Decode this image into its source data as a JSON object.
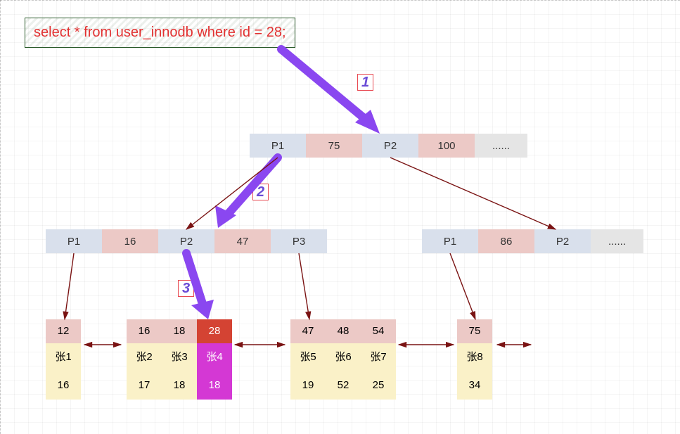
{
  "sql": "select * from user_innodb where id = 28;",
  "steps": {
    "s1": "1",
    "s2": "2",
    "s3": "3"
  },
  "root": {
    "c0": "P1",
    "c1": "75",
    "c2": "P2",
    "c3": "100",
    "c4": "......"
  },
  "mid_left": {
    "c0": "P1",
    "c1": "16",
    "c2": "P2",
    "c3": "47",
    "c4": "P3"
  },
  "mid_right": {
    "c0": "P1",
    "c1": "86",
    "c2": "P2",
    "c3": "......"
  },
  "leaves": [
    {
      "cols": [
        {
          "id": "12",
          "name": "张1",
          "val": "16"
        }
      ]
    },
    {
      "cols": [
        {
          "id": "16",
          "name": "张2",
          "val": "17"
        },
        {
          "id": "18",
          "name": "张3",
          "val": "18"
        },
        {
          "id": "28",
          "name": "张4",
          "val": "18",
          "hit": true
        }
      ]
    },
    {
      "cols": [
        {
          "id": "47",
          "name": "张5",
          "val": "19"
        },
        {
          "id": "48",
          "name": "张6",
          "val": "52"
        },
        {
          "id": "54",
          "name": "张7",
          "val": "25"
        }
      ]
    },
    {
      "cols": [
        {
          "id": "75",
          "name": "张8",
          "val": "34"
        }
      ]
    }
  ],
  "colors": {
    "search_arrow": "#8a47f0",
    "tree_arrow": "#7a1313"
  },
  "chart_data": {
    "type": "tree",
    "title": "B+ tree index search path for id = 28 on user_innodb",
    "query": "select * from user_innodb where id = 28;",
    "search_path_step_labels": [
      "1",
      "2",
      "3"
    ],
    "root_node": {
      "entries": [
        {
          "pointer": "P1",
          "key": 75
        },
        {
          "pointer": "P2",
          "key": 100
        }
      ],
      "has_more": true
    },
    "internal_nodes": [
      {
        "id": "mid_left",
        "entries": [
          {
            "pointer": "P1",
            "key": 16
          },
          {
            "pointer": "P2",
            "key": 47
          },
          {
            "pointer": "P3"
          }
        ]
      },
      {
        "id": "mid_right",
        "entries": [
          {
            "pointer": "P1",
            "key": 86
          },
          {
            "pointer": "P2"
          }
        ],
        "has_more": true
      }
    ],
    "leaf_nodes": [
      {
        "id": "L1",
        "rows": [
          {
            "id": 12,
            "name": "张1",
            "val": 16
          }
        ]
      },
      {
        "id": "L2",
        "rows": [
          {
            "id": 16,
            "name": "张2",
            "val": 17
          },
          {
            "id": 18,
            "name": "张3",
            "val": 18
          },
          {
            "id": 28,
            "name": "张4",
            "val": 18,
            "matched": true
          }
        ]
      },
      {
        "id": "L3",
        "rows": [
          {
            "id": 47,
            "name": "张5",
            "val": 19
          },
          {
            "id": 48,
            "name": "张6",
            "val": 52
          },
          {
            "id": 54,
            "name": "张7",
            "val": 25
          }
        ]
      },
      {
        "id": "L4",
        "rows": [
          {
            "id": 75,
            "name": "张8",
            "val": 34
          }
        ]
      }
    ],
    "tree_edges": [
      [
        "root.P1",
        "mid_left"
      ],
      [
        "root.P2",
        "mid_right"
      ],
      [
        "mid_left.P1",
        "L1"
      ],
      [
        "mid_left.P2",
        "L2"
      ],
      [
        "mid_left.P3",
        "L3"
      ],
      [
        "mid_right.P1",
        "L4"
      ]
    ],
    "leaf_sibling_links": [
      "L1<->L2",
      "L2<->L3",
      "L3<->L4",
      "L4->..."
    ],
    "search_path": [
      "root",
      "root.P1->mid_left",
      "mid_left.P2->L2",
      "L2.id=28"
    ]
  }
}
